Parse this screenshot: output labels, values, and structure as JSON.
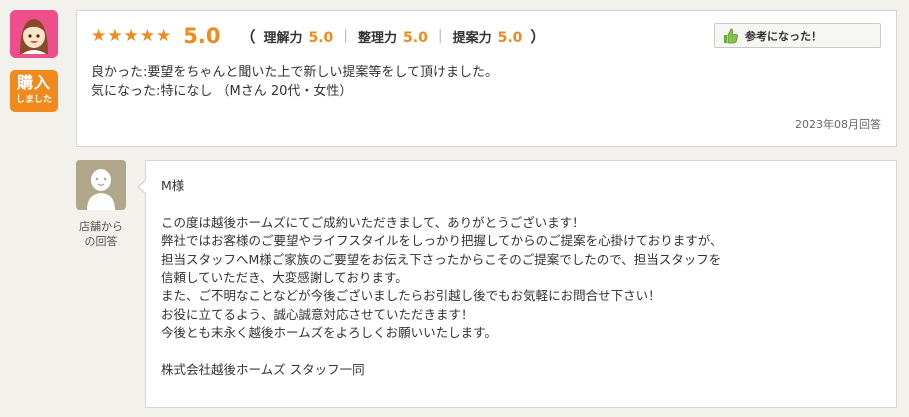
{
  "reviewer": {
    "avatar_icon": "female-face-icon",
    "purchase_badge": {
      "main": "購入",
      "sub": "しました"
    }
  },
  "review": {
    "star_count": 5,
    "overall_score": "5.0",
    "open_paren": "（",
    "close_paren": "）",
    "sub_ratings": [
      {
        "label": "理解力",
        "score": "5.0"
      },
      {
        "label": "整理力",
        "score": "5.0"
      },
      {
        "label": "提案力",
        "score": "5.0"
      }
    ],
    "separator": "|",
    "helpful_button": {
      "label": "参考になった！",
      "icon": "thumbs-up-icon"
    },
    "text_lines": [
      "良かった:要望をちゃんと聞いた上で新しい提案等をして頂けました。",
      "気になった:特になし （Mさん 20代・女性）"
    ],
    "date": "2023年08月回答"
  },
  "store_reply": {
    "avatar_icon": "store-staff-icon",
    "label_line1": "店舗から",
    "label_line2": "の回答",
    "lines": [
      "M様",
      "",
      "この度は越後ホームズにてご成約いただきまして、ありがとうございます！",
      "弊社ではお客様のご要望やライフスタイルをしっかり把握してからのご提案を心掛けておりますが、",
      "担当スタッフへM様ご家族のご要望をお伝え下さったからこそのご提案でしたので、担当スタッフを",
      "信頼していただき、大変感謝しております。",
      "また、ご不明なことなどが今後ございましたらお引越し後でもお気軽にお問合せ下さい！",
      "お役に立てるよう、誠心誠意対応させていただきます！",
      "今後とも末永く越後ホームズをよろしくお願いいたします。",
      "",
      "株式会社越後ホームズ スタッフ一同"
    ]
  },
  "colors": {
    "accent": "#f08a1c",
    "avatar_bg": "#ee4f8c",
    "store_avatar_bg": "#b0a689",
    "page_bg": "#f3f1eb"
  }
}
